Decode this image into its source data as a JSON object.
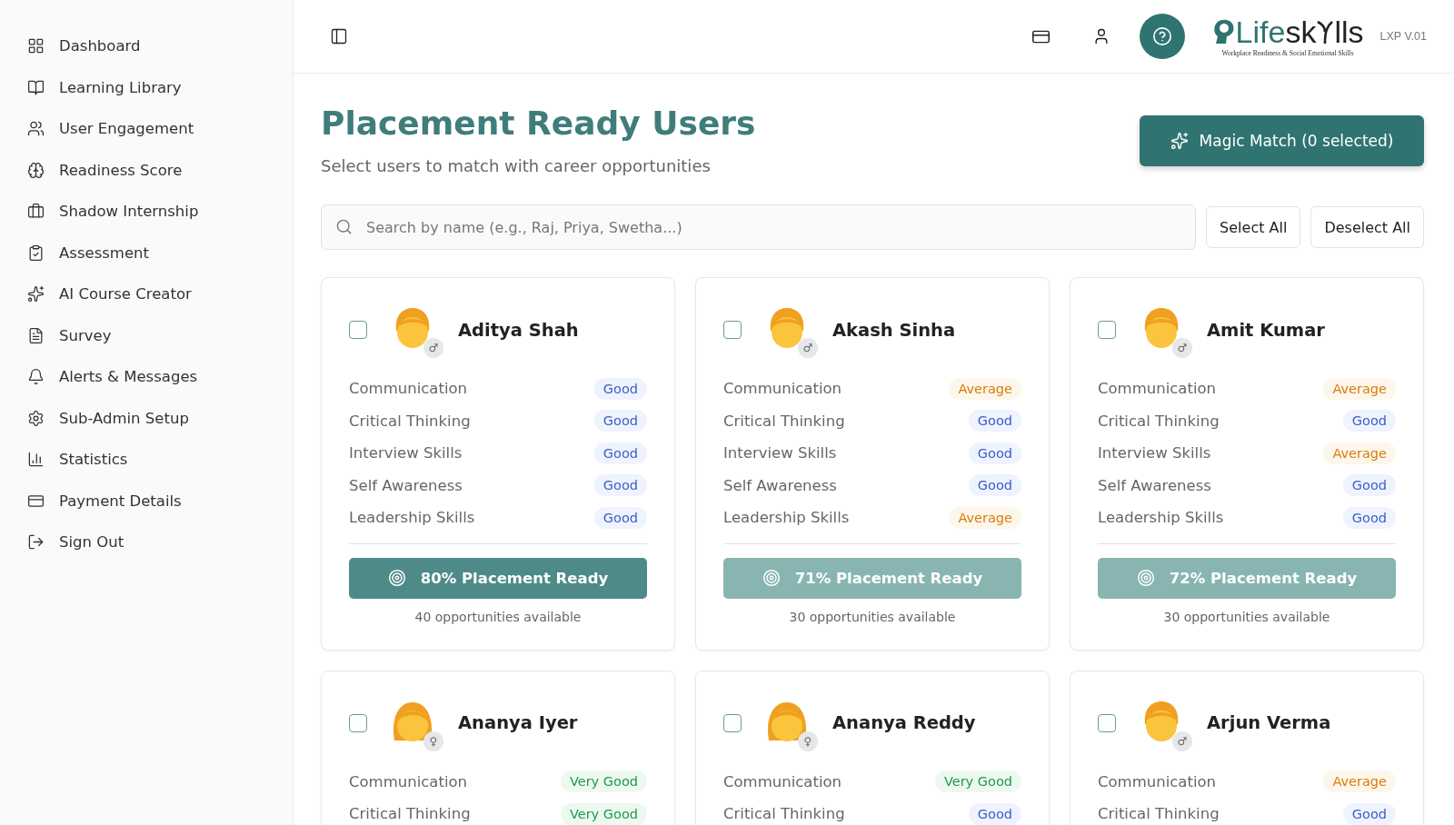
{
  "sidebar": {
    "items": [
      {
        "label": "Dashboard"
      },
      {
        "label": "Learning Library"
      },
      {
        "label": "User Engagement"
      },
      {
        "label": "Readiness Score"
      },
      {
        "label": "Shadow Internship"
      },
      {
        "label": "Assessment"
      },
      {
        "label": "AI Course Creator"
      },
      {
        "label": "Survey"
      },
      {
        "label": "Alerts & Messages"
      },
      {
        "label": "Sub-Admin Setup"
      },
      {
        "label": "Statistics"
      },
      {
        "label": "Payment Details"
      },
      {
        "label": "Sign Out"
      }
    ]
  },
  "header": {
    "logo": {
      "parts": [
        "Life",
        "sk",
        "lls"
      ],
      "tagline": "Workplace Readiness & Social Emotional Skills"
    },
    "version": "LXP V.01"
  },
  "page": {
    "title": "Placement Ready Users",
    "subtitle": "Select users to match with career opportunities",
    "magic_button": "Magic Match (0 selected)"
  },
  "search": {
    "placeholder": "Search by name (e.g., Raj, Priya, Swetha...)"
  },
  "actions": [
    "Select All",
    "Deselect All"
  ],
  "users": [
    {
      "name": "Aditya Shah",
      "gender_symbol": "♂",
      "long_hair": false,
      "checked": false,
      "skills": [
        {
          "name": "Communication",
          "rating": "Good",
          "kind": "good"
        },
        {
          "name": "Critical Thinking",
          "rating": "Good",
          "kind": "good"
        },
        {
          "name": "Interview Skills",
          "rating": "Good",
          "kind": "good"
        },
        {
          "name": "Self Awareness",
          "rating": "Good",
          "kind": "good"
        },
        {
          "name": "Leadership Skills",
          "rating": "Good",
          "kind": "good"
        }
      ],
      "readiness": "80% Placement Ready",
      "strong": true,
      "opportunities": "40 opportunities available"
    },
    {
      "name": "Akash Sinha",
      "gender_symbol": "♂",
      "long_hair": false,
      "checked": false,
      "skills": [
        {
          "name": "Communication",
          "rating": "Average",
          "kind": "average"
        },
        {
          "name": "Critical Thinking",
          "rating": "Good",
          "kind": "good"
        },
        {
          "name": "Interview Skills",
          "rating": "Good",
          "kind": "good"
        },
        {
          "name": "Self Awareness",
          "rating": "Good",
          "kind": "good"
        },
        {
          "name": "Leadership Skills",
          "rating": "Average",
          "kind": "average"
        }
      ],
      "readiness": "71% Placement Ready",
      "strong": false,
      "opportunities": "30 opportunities available"
    },
    {
      "name": "Amit Kumar",
      "gender_symbol": "♂",
      "long_hair": false,
      "checked": false,
      "skills": [
        {
          "name": "Communication",
          "rating": "Average",
          "kind": "average"
        },
        {
          "name": "Critical Thinking",
          "rating": "Good",
          "kind": "good"
        },
        {
          "name": "Interview Skills",
          "rating": "Average",
          "kind": "average"
        },
        {
          "name": "Self Awareness",
          "rating": "Good",
          "kind": "good"
        },
        {
          "name": "Leadership Skills",
          "rating": "Good",
          "kind": "good"
        }
      ],
      "readiness": "72% Placement Ready",
      "strong": false,
      "opportunities": "30 opportunities available"
    },
    {
      "name": "Ananya Iyer",
      "gender_symbol": "♀",
      "long_hair": true,
      "checked": false,
      "skills": [
        {
          "name": "Communication",
          "rating": "Very Good",
          "kind": "very_good"
        },
        {
          "name": "Critical Thinking",
          "rating": "Very Good",
          "kind": "very_good"
        }
      ]
    },
    {
      "name": "Ananya Reddy",
      "gender_symbol": "♀",
      "long_hair": true,
      "checked": false,
      "skills": [
        {
          "name": "Communication",
          "rating": "Very Good",
          "kind": "very_good"
        },
        {
          "name": "Critical Thinking",
          "rating": "Good",
          "kind": "good"
        }
      ]
    },
    {
      "name": "Arjun Verma",
      "gender_symbol": "♂",
      "long_hair": false,
      "checked": false,
      "skills": [
        {
          "name": "Communication",
          "rating": "Average",
          "kind": "average"
        },
        {
          "name": "Critical Thinking",
          "rating": "Good",
          "kind": "good"
        }
      ]
    }
  ]
}
